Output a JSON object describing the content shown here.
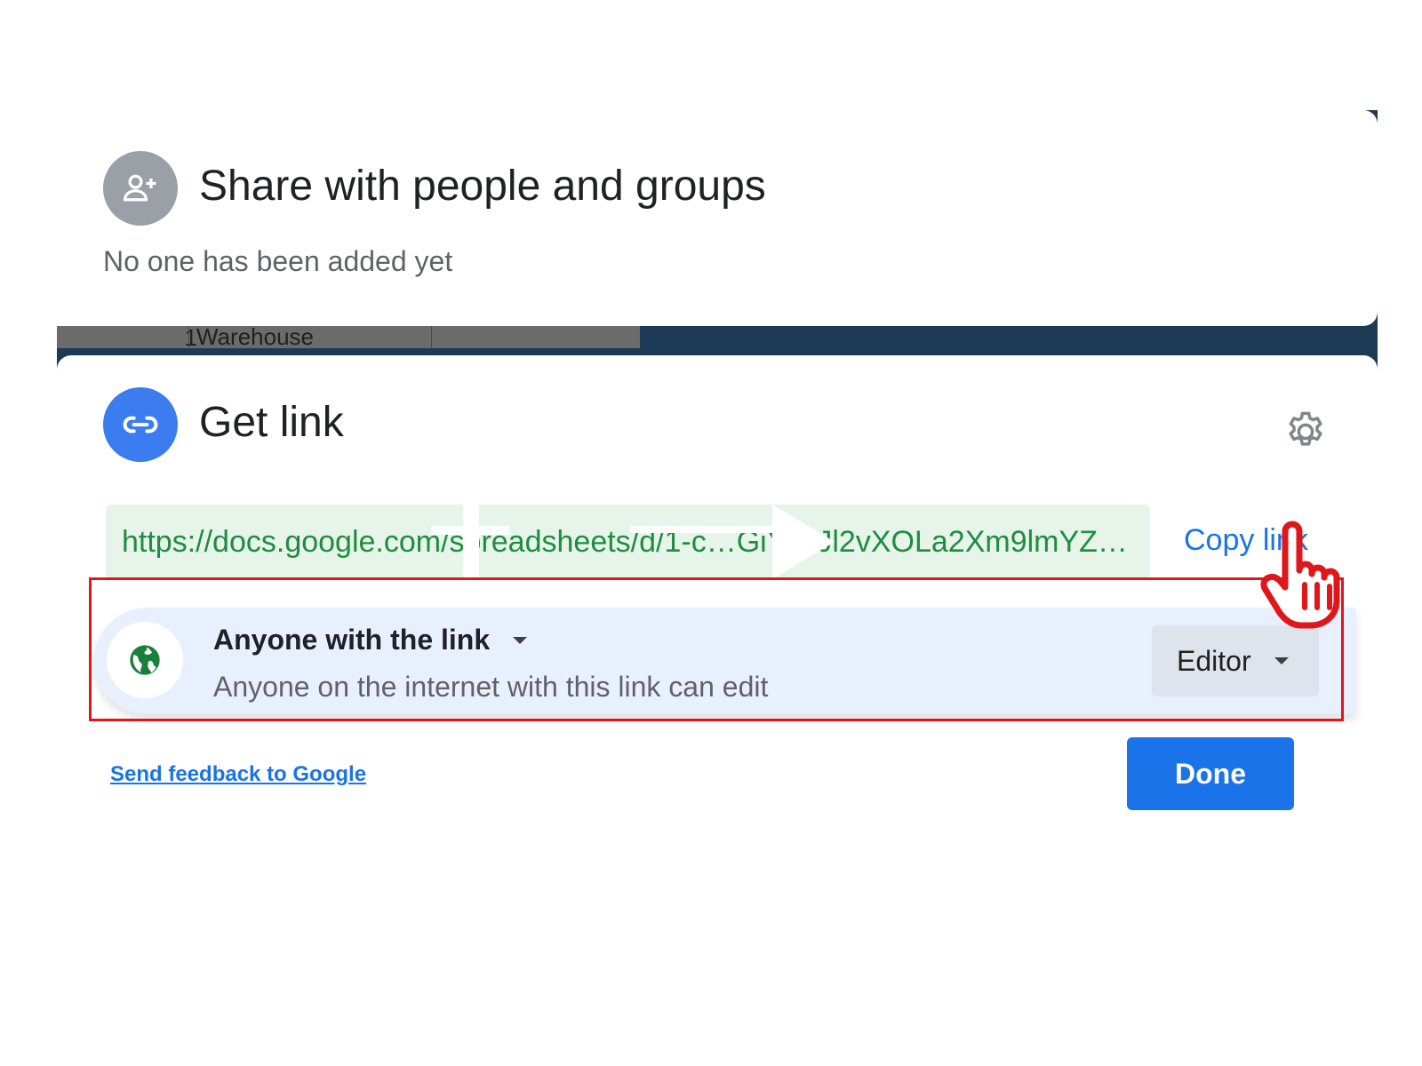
{
  "background_sheet": {
    "row_number": "1",
    "cell_value": "Warehouse"
  },
  "share_section": {
    "icon": "add-person-icon",
    "title": "Share with people and groups",
    "subtitle": "No one has been added yet"
  },
  "link_section": {
    "icon": "link-icon",
    "title": "Get link",
    "settings_icon": "gear-icon",
    "url": "https://docs.google.com/spreadsheets/d/1-c…GiYjctJl2vXOLa2Xm9lmYZ…",
    "copy_link_label": "Copy link"
  },
  "access": {
    "icon": "globe-icon",
    "scope_label": "Anyone with the link",
    "description": "Anyone on the internet with this link can edit",
    "role_label": "Editor"
  },
  "footer": {
    "feedback_link": "Send feedback to Google",
    "done_label": "Done"
  },
  "colors": {
    "accent_blue": "#1a73e8",
    "url_green": "#1e8e3e",
    "url_bg": "#e6f4ea",
    "access_bg": "#e8f0fe",
    "highlight_red": "#e0161b"
  },
  "annotations": {
    "cursor_icon": "hand-pointer-icon"
  }
}
